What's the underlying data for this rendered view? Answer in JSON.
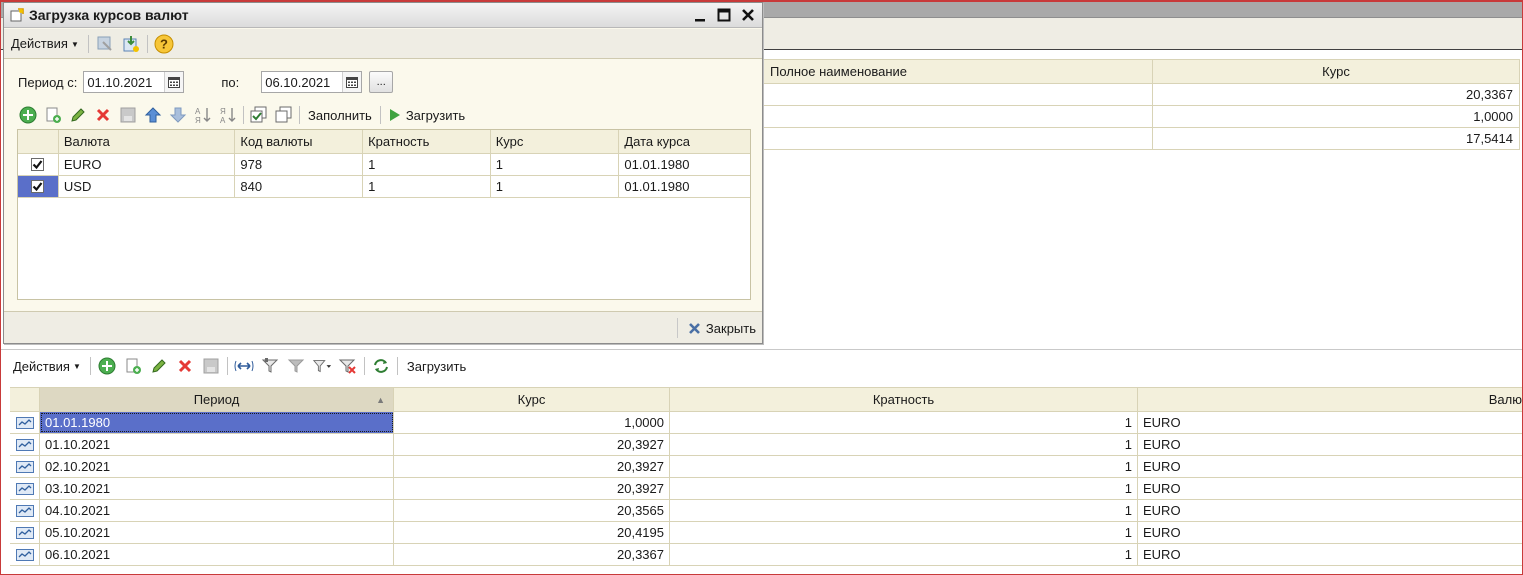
{
  "dialog": {
    "title": "Загрузка курсов валют",
    "menu_actions": "Действия",
    "period_from_label": "Период с:",
    "period_from": "01.10.2021",
    "period_to_label": "по:",
    "period_to": "06.10.2021",
    "dots_label": "...",
    "fill_label": "Заполнить",
    "load_label": "Загрузить",
    "close_label": "Закрыть",
    "columns": [
      "Валюта",
      "Код валюты",
      "Кратность",
      "Курс",
      "Дата курса"
    ],
    "rows": [
      {
        "checked": true,
        "currency": "EURO",
        "code": "978",
        "multiplicity": "1",
        "rate": "1",
        "date": "01.01.1980"
      },
      {
        "checked": true,
        "currency": "USD",
        "code": "840",
        "multiplicity": "1",
        "rate": "1",
        "date": "01.01.1980"
      }
    ]
  },
  "background_grid": {
    "columns": [
      "Полное наименование",
      "Курс"
    ],
    "rows": [
      {
        "name": "",
        "rate": "20,3367"
      },
      {
        "name": "",
        "rate": "1,0000"
      },
      {
        "name": "",
        "rate": "17,5414"
      }
    ]
  },
  "lower_panel": {
    "menu_actions": "Действия",
    "load_label": "Загрузить",
    "columns": [
      "Период",
      "Курс",
      "Кратность",
      "Валю"
    ],
    "rows": [
      {
        "period": "01.01.1980",
        "rate": "1,0000",
        "multiplicity": "1",
        "currency": "EURO"
      },
      {
        "period": "01.10.2021",
        "rate": "20,3927",
        "multiplicity": "1",
        "currency": "EURO"
      },
      {
        "period": "02.10.2021",
        "rate": "20,3927",
        "multiplicity": "1",
        "currency": "EURO"
      },
      {
        "period": "03.10.2021",
        "rate": "20,3927",
        "multiplicity": "1",
        "currency": "EURO"
      },
      {
        "period": "04.10.2021",
        "rate": "20,3565",
        "multiplicity": "1",
        "currency": "EURO"
      },
      {
        "period": "05.10.2021",
        "rate": "20,4195",
        "multiplicity": "1",
        "currency": "EURO"
      },
      {
        "period": "06.10.2021",
        "rate": "20,3367",
        "multiplicity": "1",
        "currency": "EURO"
      }
    ]
  },
  "colors": {
    "selection": "#5a6fc9",
    "header_bg": "#f3f0dc",
    "grid_line": "#d8d3b6",
    "frame_red": "#c83a3a"
  }
}
